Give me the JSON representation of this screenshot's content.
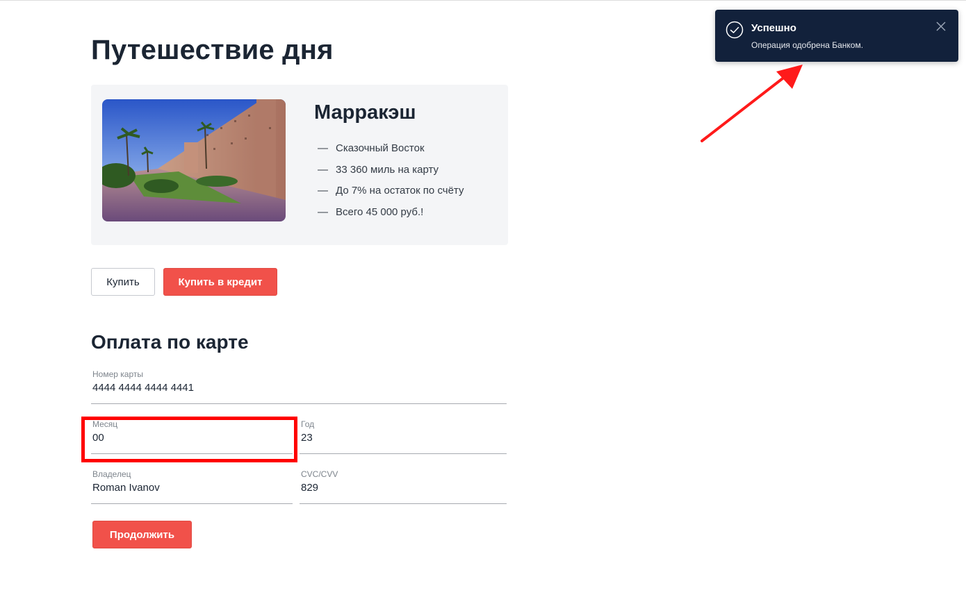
{
  "page": {
    "title": "Путешествие дня"
  },
  "offer": {
    "city": "Марракэш",
    "features": [
      "Сказочный Восток",
      "33 360 миль на карту",
      "До 7% на остаток по счёту",
      "Всего 45 000 руб.!"
    ],
    "dash": "—"
  },
  "buttons": {
    "buy": "Купить",
    "buy_credit": "Купить в кредит",
    "continue": "Продолжить"
  },
  "payment": {
    "title": "Оплата по карте",
    "card_number": {
      "label": "Номер карты",
      "value": "4444 4444 4444 4441"
    },
    "month": {
      "label": "Месяц",
      "value": "00"
    },
    "year": {
      "label": "Год",
      "value": "23"
    },
    "owner": {
      "label": "Владелец",
      "value": "Roman Ivanov"
    },
    "cvc": {
      "label": "CVC/CVV",
      "value": "829"
    }
  },
  "toast": {
    "title": "Успешно",
    "message": "Операция одобрена Банком.",
    "icon": "check-circle-icon"
  },
  "colors": {
    "accent": "#f1514a",
    "toast_bg": "#12213b",
    "annotation": "#ff0000"
  }
}
